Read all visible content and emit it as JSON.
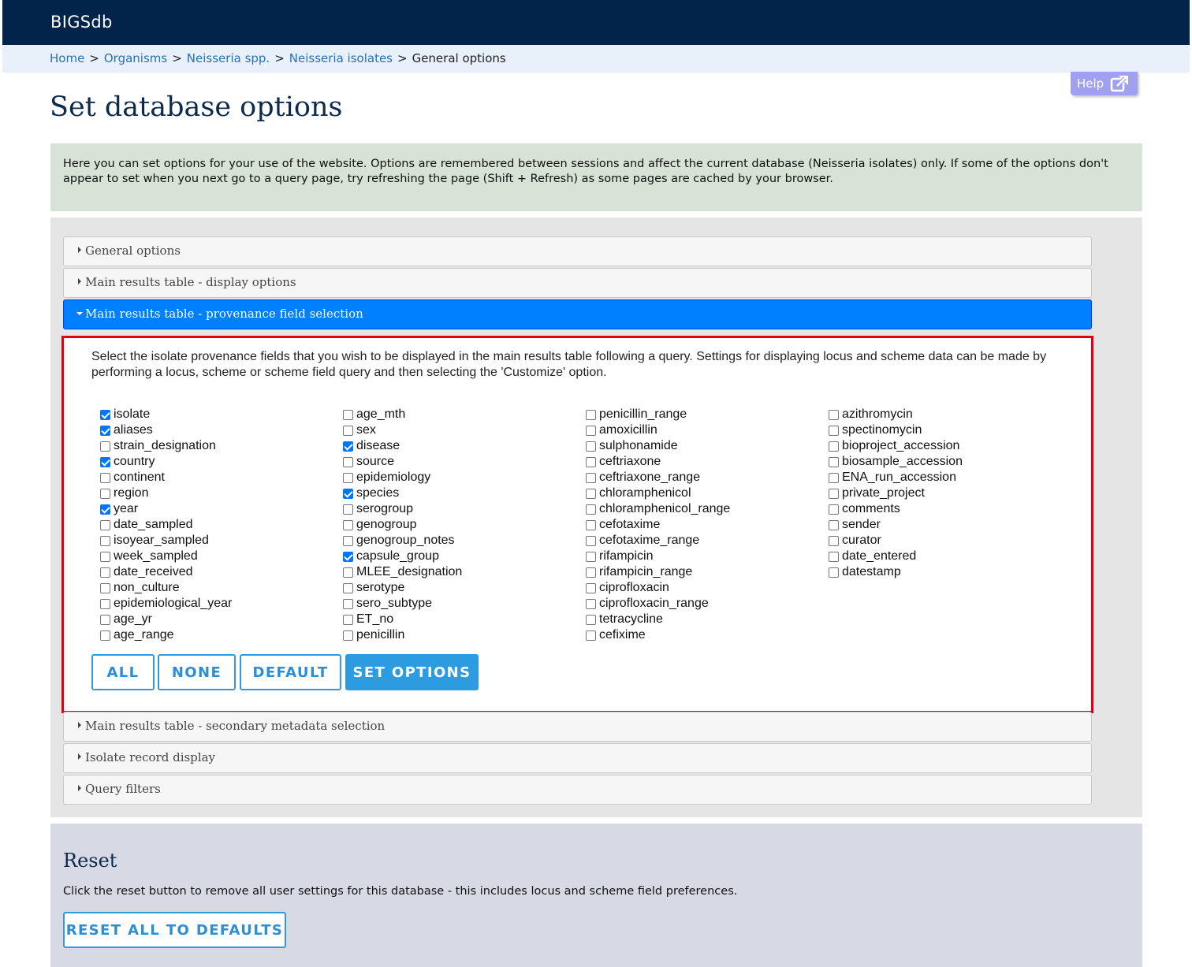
{
  "app": {
    "brand": "BIGSdb"
  },
  "breadcrumb": {
    "items": [
      "Home",
      "Organisms",
      "Neisseria spp.",
      "Neisseria isolates"
    ],
    "current": "General options",
    "separator": ">"
  },
  "help": {
    "label": "Help",
    "icon": "external-link-icon"
  },
  "page": {
    "title": "Set database options"
  },
  "intro": {
    "text": "Here you can set options for your use of the website. Options are remembered between sessions and affect the current database (Neisseria isolates) only. If some of the options don't appear to set when you next go to a query page, try refreshing the page (Shift + Refresh) as some pages are cached by your browser."
  },
  "accordion": {
    "sections": [
      "General options",
      "Main results table - display options",
      "Main results table - provenance field selection",
      "Main results table - secondary metadata selection",
      "Isolate record display",
      "Query filters"
    ],
    "active_index": 2
  },
  "provenance": {
    "description": "Select the isolate provenance fields that you wish to be displayed in the main results table following a query. Settings for displaying locus and scheme data can be made by performing a locus, scheme or scheme field query and then selecting the 'Customize' option.",
    "columns": [
      [
        {
          "label": "isolate",
          "checked": true
        },
        {
          "label": "aliases",
          "checked": true
        },
        {
          "label": "strain_designation",
          "checked": false
        },
        {
          "label": "country",
          "checked": true
        },
        {
          "label": "continent",
          "checked": false
        },
        {
          "label": "region",
          "checked": false
        },
        {
          "label": "year",
          "checked": true
        },
        {
          "label": "date_sampled",
          "checked": false
        },
        {
          "label": "isoyear_sampled",
          "checked": false
        },
        {
          "label": "week_sampled",
          "checked": false
        },
        {
          "label": "date_received",
          "checked": false
        },
        {
          "label": "non_culture",
          "checked": false
        },
        {
          "label": "epidemiological_year",
          "checked": false
        },
        {
          "label": "age_yr",
          "checked": false
        },
        {
          "label": "age_range",
          "checked": false
        }
      ],
      [
        {
          "label": "age_mth",
          "checked": false
        },
        {
          "label": "sex",
          "checked": false
        },
        {
          "label": "disease",
          "checked": true
        },
        {
          "label": "source",
          "checked": false
        },
        {
          "label": "epidemiology",
          "checked": false
        },
        {
          "label": "species",
          "checked": true
        },
        {
          "label": "serogroup",
          "checked": false
        },
        {
          "label": "genogroup",
          "checked": false
        },
        {
          "label": "genogroup_notes",
          "checked": false
        },
        {
          "label": "capsule_group",
          "checked": true
        },
        {
          "label": "MLEE_designation",
          "checked": false
        },
        {
          "label": "serotype",
          "checked": false
        },
        {
          "label": "sero_subtype",
          "checked": false
        },
        {
          "label": "ET_no",
          "checked": false
        },
        {
          "label": "penicillin",
          "checked": false
        }
      ],
      [
        {
          "label": "penicillin_range",
          "checked": false
        },
        {
          "label": "amoxicillin",
          "checked": false
        },
        {
          "label": "sulphonamide",
          "checked": false
        },
        {
          "label": "ceftriaxone",
          "checked": false
        },
        {
          "label": "ceftriaxone_range",
          "checked": false
        },
        {
          "label": "chloramphenicol",
          "checked": false
        },
        {
          "label": "chloramphenicol_range",
          "checked": false
        },
        {
          "label": "cefotaxime",
          "checked": false
        },
        {
          "label": "cefotaxime_range",
          "checked": false
        },
        {
          "label": "rifampicin",
          "checked": false
        },
        {
          "label": "rifampicin_range",
          "checked": false
        },
        {
          "label": "ciprofloxacin",
          "checked": false
        },
        {
          "label": "ciprofloxacin_range",
          "checked": false
        },
        {
          "label": "tetracycline",
          "checked": false
        },
        {
          "label": "cefixime",
          "checked": false
        }
      ],
      [
        {
          "label": "azithromycin",
          "checked": false
        },
        {
          "label": "spectinomycin",
          "checked": false
        },
        {
          "label": "bioproject_accession",
          "checked": false
        },
        {
          "label": "biosample_accession",
          "checked": false
        },
        {
          "label": "ENA_run_accession",
          "checked": false
        },
        {
          "label": "private_project",
          "checked": false
        },
        {
          "label": "comments",
          "checked": false
        },
        {
          "label": "sender",
          "checked": false
        },
        {
          "label": "curator",
          "checked": false
        },
        {
          "label": "date_entered",
          "checked": false
        },
        {
          "label": "datestamp",
          "checked": false
        }
      ]
    ],
    "buttons": {
      "all": "ALL",
      "none": "NONE",
      "default": "DEFAULT",
      "set": "SET OPTIONS"
    }
  },
  "reset": {
    "heading": "Reset",
    "text": "Click the reset button to remove all user settings for this database - this includes locus and scheme field preferences.",
    "button": "RESET ALL TO DEFAULTS"
  },
  "colors": {
    "header_bg": "#02234a",
    "breadcrumb_bg": "#e8f1fb",
    "active_section": "#007fff",
    "highlight_border": "#e0000b",
    "button_accent": "#2d9be0"
  }
}
